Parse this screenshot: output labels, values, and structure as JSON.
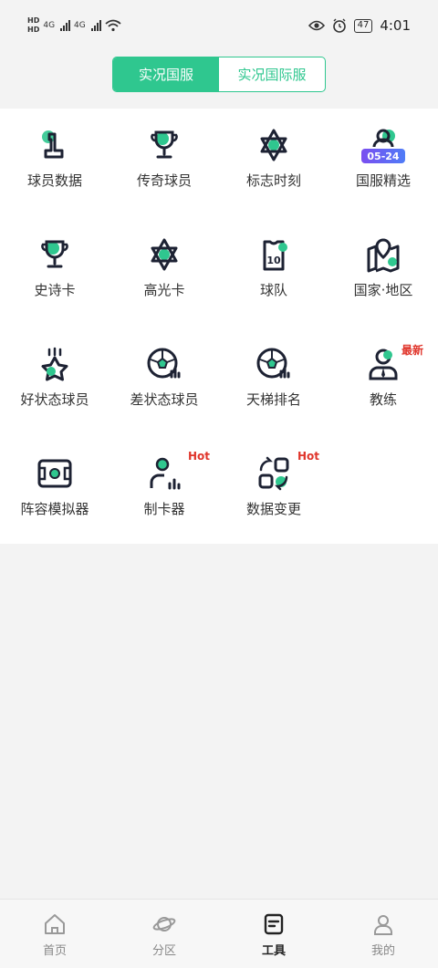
{
  "status_bar": {
    "hd1": "HD",
    "hd2": "HD",
    "net1": "4G",
    "net2": "4G",
    "battery": "47",
    "time": "4:01"
  },
  "segment": {
    "tabs": [
      {
        "label": "实况国服",
        "active": true
      },
      {
        "label": "实况国际服",
        "active": false
      }
    ]
  },
  "tools": [
    {
      "label": "球员数据",
      "icon": "player-number-icon"
    },
    {
      "label": "传奇球员",
      "icon": "trophy-icon"
    },
    {
      "label": "标志时刻",
      "icon": "star-of-david-icon"
    },
    {
      "label": "国服精选",
      "icon": "player-select-icon",
      "date_badge": "05-24"
    },
    {
      "label": "史诗卡",
      "icon": "trophy-icon"
    },
    {
      "label": "高光卡",
      "icon": "star-of-david-icon"
    },
    {
      "label": "球队",
      "icon": "jersey-icon",
      "jersey_number": "10"
    },
    {
      "label": "国家·地区",
      "icon": "map-pin-icon"
    },
    {
      "label": "好状态球员",
      "icon": "star-icon"
    },
    {
      "label": "差状态球员",
      "icon": "ball-chart-icon"
    },
    {
      "label": "天梯排名",
      "icon": "ball-chart-icon"
    },
    {
      "label": "教练",
      "icon": "coach-icon",
      "tag": "最新"
    },
    {
      "label": "阵容模拟器",
      "icon": "pitch-icon"
    },
    {
      "label": "制卡器",
      "icon": "card-maker-icon",
      "tag": "Hot"
    },
    {
      "label": "数据变更",
      "icon": "data-change-icon",
      "tag": "Hot"
    }
  ],
  "tabbar": [
    {
      "label": "首页",
      "icon": "home-icon",
      "active": false
    },
    {
      "label": "分区",
      "icon": "planet-icon",
      "active": false
    },
    {
      "label": "工具",
      "icon": "tools-icon",
      "active": true
    },
    {
      "label": "我的",
      "icon": "user-icon",
      "active": false
    }
  ],
  "colors": {
    "accent": "#2fc78f",
    "hot": "#e0352b",
    "icon_dark": "#1d2233"
  }
}
